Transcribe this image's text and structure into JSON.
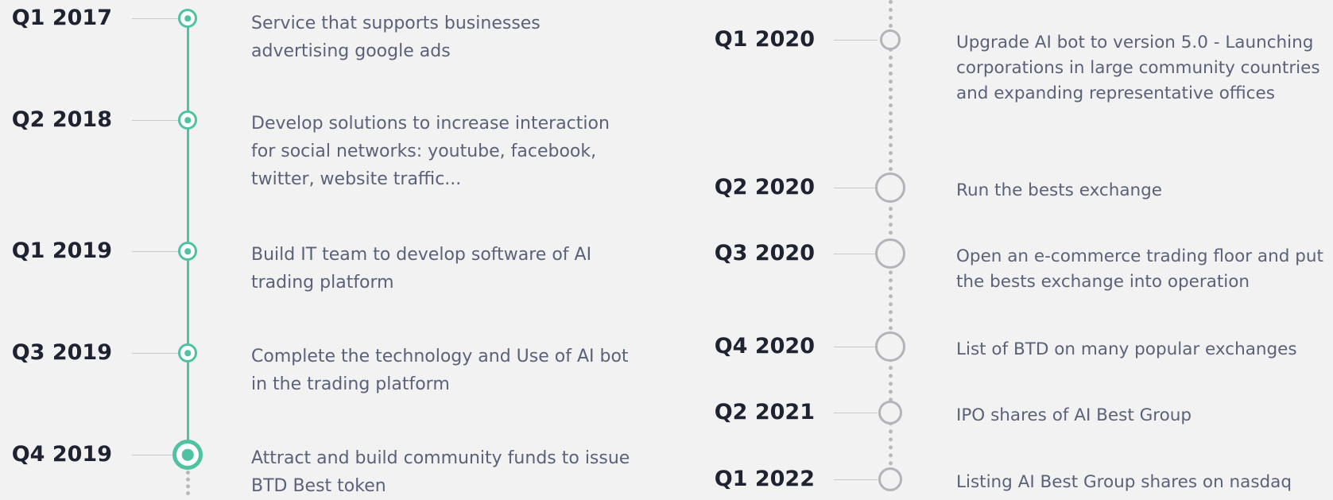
{
  "palette": {
    "done": "#4fc3a1",
    "todo": "#b3b3b9",
    "label": "#1f2230",
    "text": "#5b6178",
    "background": "#f2f2f2"
  },
  "left_column": [
    {
      "quarter": "Q1 2017",
      "status": "done",
      "description": "Service that supports businesses advertising google ads"
    },
    {
      "quarter": "Q2 2018",
      "status": "done",
      "description": "Develop solutions to increase interaction for social networks: youtube, facebook, twitter, website traffic..."
    },
    {
      "quarter": "Q1 2019",
      "status": "done",
      "description": "Build IT team to develop software of AI trading platform"
    },
    {
      "quarter": "Q3 2019",
      "status": "done",
      "description": "Complete the technology and Use of AI bot in the trading platform"
    },
    {
      "quarter": "Q4 2019",
      "status": "current",
      "description": "Attract and build community funds to issue BTD Best token"
    }
  ],
  "right_column": [
    {
      "quarter": "Q1 2020",
      "status": "upcoming",
      "description": "Upgrade AI bot to version 5.0 - Launching corporations in large community countries and expanding representative offices"
    },
    {
      "quarter": "Q2 2020",
      "status": "upcoming",
      "description": "Run the bests exchange"
    },
    {
      "quarter": "Q3 2020",
      "status": "upcoming",
      "description": "Open an e-commerce trading floor and put the bests exchange into operation"
    },
    {
      "quarter": "Q4 2020",
      "status": "upcoming",
      "description": "List of BTD on many popular exchanges"
    },
    {
      "quarter": "Q2 2021",
      "status": "upcoming",
      "description": "IPO shares of AI Best Group"
    },
    {
      "quarter": "Q1 2022",
      "status": "upcoming",
      "description": "Listing AI Best Group shares on nasdaq"
    }
  ]
}
